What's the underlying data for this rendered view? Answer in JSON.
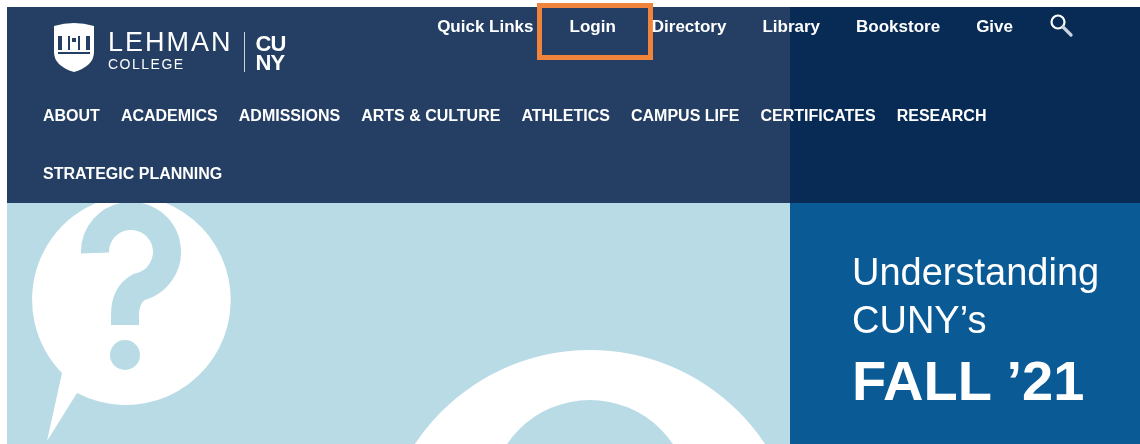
{
  "logo": {
    "name": "LEHMAN",
    "subtitle": "COLLEGE",
    "partner_top": "CU",
    "partner_bottom": "NY"
  },
  "quick_links": [
    {
      "label": "Quick Links",
      "highlighted": false
    },
    {
      "label": "Login",
      "highlighted": true
    },
    {
      "label": "Directory",
      "highlighted": false
    },
    {
      "label": "Library",
      "highlighted": false
    },
    {
      "label": "Bookstore",
      "highlighted": false
    },
    {
      "label": "Give",
      "highlighted": false
    }
  ],
  "nav": [
    "ABOUT",
    "ACADEMICS",
    "ADMISSIONS",
    "ARTS & CULTURE",
    "ATHLETICS",
    "CAMPUS LIFE",
    "CERTIFICATES",
    "RESEARCH",
    "STRATEGIC PLANNING"
  ],
  "hero": {
    "lines": [
      {
        "text": "Understanding",
        "kind": "regular"
      },
      {
        "text": "CUNY’s",
        "kind": "regular"
      },
      {
        "text": "FALL ’21",
        "kind": "bold"
      }
    ]
  }
}
